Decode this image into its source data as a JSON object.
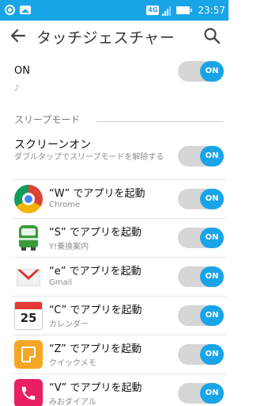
{
  "status_bar": {
    "network": "4G",
    "time": "23:57"
  },
  "app_bar": {
    "title": "タッチジェスチャー"
  },
  "master": {
    "label": "ON",
    "toggle": "ON",
    "hint": "♪"
  },
  "section": {
    "title": "スリープモード"
  },
  "screen_on": {
    "title": "スクリーンオン",
    "subtitle": "ダブルタップでスリープモードを解除する",
    "toggle": "ON"
  },
  "gestures": [
    {
      "title": "“W” でアプリを起動",
      "subtitle": "Chrome",
      "toggle": "ON",
      "icon": "chrome-icon"
    },
    {
      "title": "“S” でアプリを起動",
      "subtitle": "Y!乗換案内",
      "toggle": "ON",
      "icon": "train-icon"
    },
    {
      "title": "“e” でアプリを起動",
      "subtitle": "Gmail",
      "toggle": "ON",
      "icon": "gmail-icon"
    },
    {
      "title": "“C” でアプリを起動",
      "subtitle": "カレンダー",
      "toggle": "ON",
      "icon": "calendar-icon",
      "badge": "25"
    },
    {
      "title": "“Z” でアプリを起動",
      "subtitle": "クイックメモ",
      "toggle": "ON",
      "icon": "quick-memo-icon"
    },
    {
      "title": "“V” でアプリを起動",
      "subtitle": "みおダイアル",
      "toggle": "ON",
      "icon": "phone-icon"
    }
  ],
  "colors": {
    "accent": "#1aa4e8",
    "toggle_track": "#d6d6d6"
  }
}
